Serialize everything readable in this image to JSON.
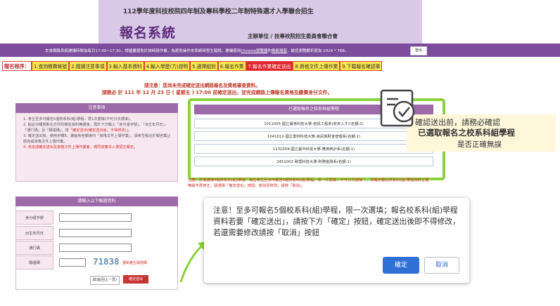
{
  "header": {
    "top_title": "112學年度科技校院四年制及專科學校二年制特殊選才入學聯合招生",
    "system_title": "報名系統",
    "organizer": "主辦單位 / 技專校院招生委員會聯合會"
  },
  "notice_bar": {
    "text_before": "本會網路系統建議時間為每日17:00~17:30，請儘量避免於該時段作業，為避免操作本系統時發生錯誤，建議使用",
    "browser_link": "Chrome瀏覽器",
    "text_mid": "的",
    "privacy_link": "無痕視窗",
    "text_after": "，最佳瀏覽解析度為 1024 * 768。",
    "logout_label": "登出"
  },
  "steps": {
    "label": "報名程序：",
    "items": [
      "1.查詢繳費帳號",
      "2.閱讀注意事項",
      "3.輸入基本資料",
      "4.輸入學歷(力)證明",
      "5.選擇組別",
      "6.報名作業",
      "7.報名作業確定送出",
      "8.資格文件上傳作業",
      "9.下載報名確認單"
    ],
    "active_index": 6
  },
  "deadline": {
    "line1": "請注意：您尚未完成確定送出網路報名及資格審查資料。",
    "line2": "請務必 於 111 年 12 月 23 日 ( 星期五 ) 17:00 前確定送出，並完成網路上傳報名資格及繳費身分文件。"
  },
  "notes_panel": {
    "heading": "注意事項",
    "items": [
      {
        "text": "1. 考生至多可報名5個校系科(組)學程，限1次選填(不可分次選填)。"
      },
      {
        "text": "2. 點必仔細核對右方所列報名資料無誤後，再於下方輸入「身分證字號」、「出生年月日」、「通行碼」及「驗證碼」，按「",
        "red": "確定送出(確定送出後，不得修改)",
        "after": "」。"
      },
      {
        "text": "3. 確定送出後，使用步驟8、畫面會自動導向「資格文件上傳作業」，請考生點必於報名截止前完成資格文件上傳作業。"
      },
      {
        "text": "",
        "red": "4. 未完成確定送出及資格文件上傳作業者，視同放棄本入學招生報名。"
      }
    ]
  },
  "selected_panel": {
    "heading": "已選取報名之校系科組學程",
    "rows": [
      "1011005-國立臺灣科技大學-資訊工程系(資安人才)(名額:2)",
      "1041012-國立雲林科技大學-資訊與財金管理系(名額:1)",
      "1131004-國立臺中科技大學-應用統計系(名額:1)",
      "2451002-致理科技大學-財務金融系(名額:1)"
    ],
    "warning": "注意！您僅選擇4個校系科(組)學程！每位考生至多可報名5個校系科(組)學程，限一次選填 ( 不可分次選填 ) ，如確定報名校系科(組)學程資料正確無誤不再修正，請選擇「確定送出」按鈕；若尚須修改，請按「取消」。"
  },
  "callout": {
    "line1": "確認送出前，請務必確認",
    "line2": "已選取報名之校系科組學程",
    "line3": "是否正確無誤"
  },
  "form": {
    "heading": "請輸入以下驗證資料",
    "fields": [
      {
        "label": "身分證字號",
        "value": ""
      },
      {
        "label": "出生年月日",
        "value": ""
      },
      {
        "label": "通行碼",
        "value": ""
      },
      {
        "label": "驗證碼",
        "value": ""
      }
    ],
    "captcha_value": "71838",
    "refresh_label": "重新產生驗證碼",
    "cancel_label": "取消(回上一頁)",
    "confirm_label": "確定送出"
  },
  "dialog": {
    "message": "注意！至多可報名5個校系科(組)學程，限一次選填；報名校系科(組)學程資料若要「確定送出」，請按下方「確定」按鈕，確定送出後即不得修改，若還需要修改請按「取消」按鈕",
    "ok_label": "確定",
    "cancel_label": "取消"
  },
  "colors": {
    "header_bg": "#d9c8e6",
    "notice_bg": "#7b4d9c",
    "panel_heading": "#9c6aa8",
    "highlight_border": "#8bd13c",
    "step_bg": "#f6e44a",
    "step_active": "#e0242b",
    "dialog_ok": "#2f6fd6"
  }
}
